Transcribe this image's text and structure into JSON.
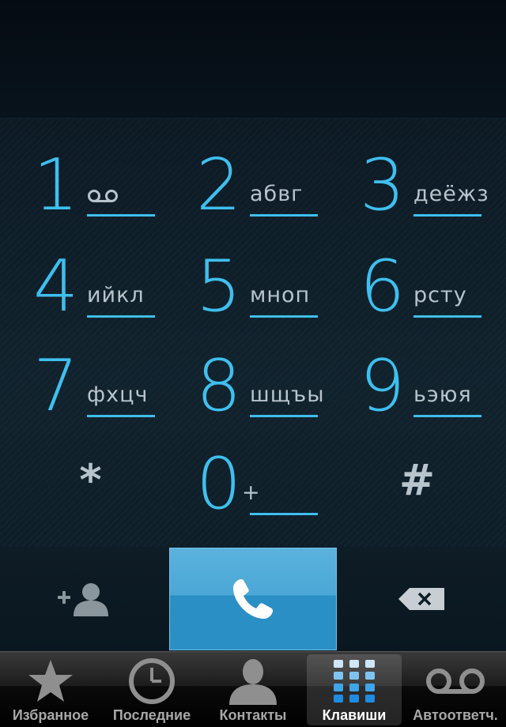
{
  "display": {
    "number": ""
  },
  "keypad": {
    "keys": [
      {
        "digit": "1",
        "letters": "",
        "icon": "voicemail-icon"
      },
      {
        "digit": "2",
        "letters": "абвг"
      },
      {
        "digit": "3",
        "letters": "деёжз"
      },
      {
        "digit": "4",
        "letters": "ийкл"
      },
      {
        "digit": "5",
        "letters": "мноп"
      },
      {
        "digit": "6",
        "letters": "рсту"
      },
      {
        "digit": "7",
        "letters": "фхцч"
      },
      {
        "digit": "8",
        "letters": "шщъы"
      },
      {
        "digit": "9",
        "letters": "ьэюя"
      },
      {
        "symbol": "*"
      },
      {
        "digit": "0",
        "letters": "+"
      },
      {
        "symbol": "#"
      }
    ]
  },
  "actions": {
    "add_contact_icon": "add-contact-icon",
    "call_icon": "phone-icon",
    "backspace_icon": "backspace-icon"
  },
  "tabs": [
    {
      "label": "Избранное",
      "icon": "star-icon",
      "active": false
    },
    {
      "label": "Последние",
      "icon": "clock-icon",
      "active": false
    },
    {
      "label": "Контакты",
      "icon": "contact-icon",
      "active": false
    },
    {
      "label": "Клавиши",
      "icon": "keypad-icon",
      "active": true
    },
    {
      "label": "Автоответч.",
      "icon": "voicemail-icon",
      "active": false
    }
  ],
  "colors": {
    "accent": "#3fbfef",
    "call_button": "#2a8fc4",
    "letters": "#b8c4cc"
  }
}
